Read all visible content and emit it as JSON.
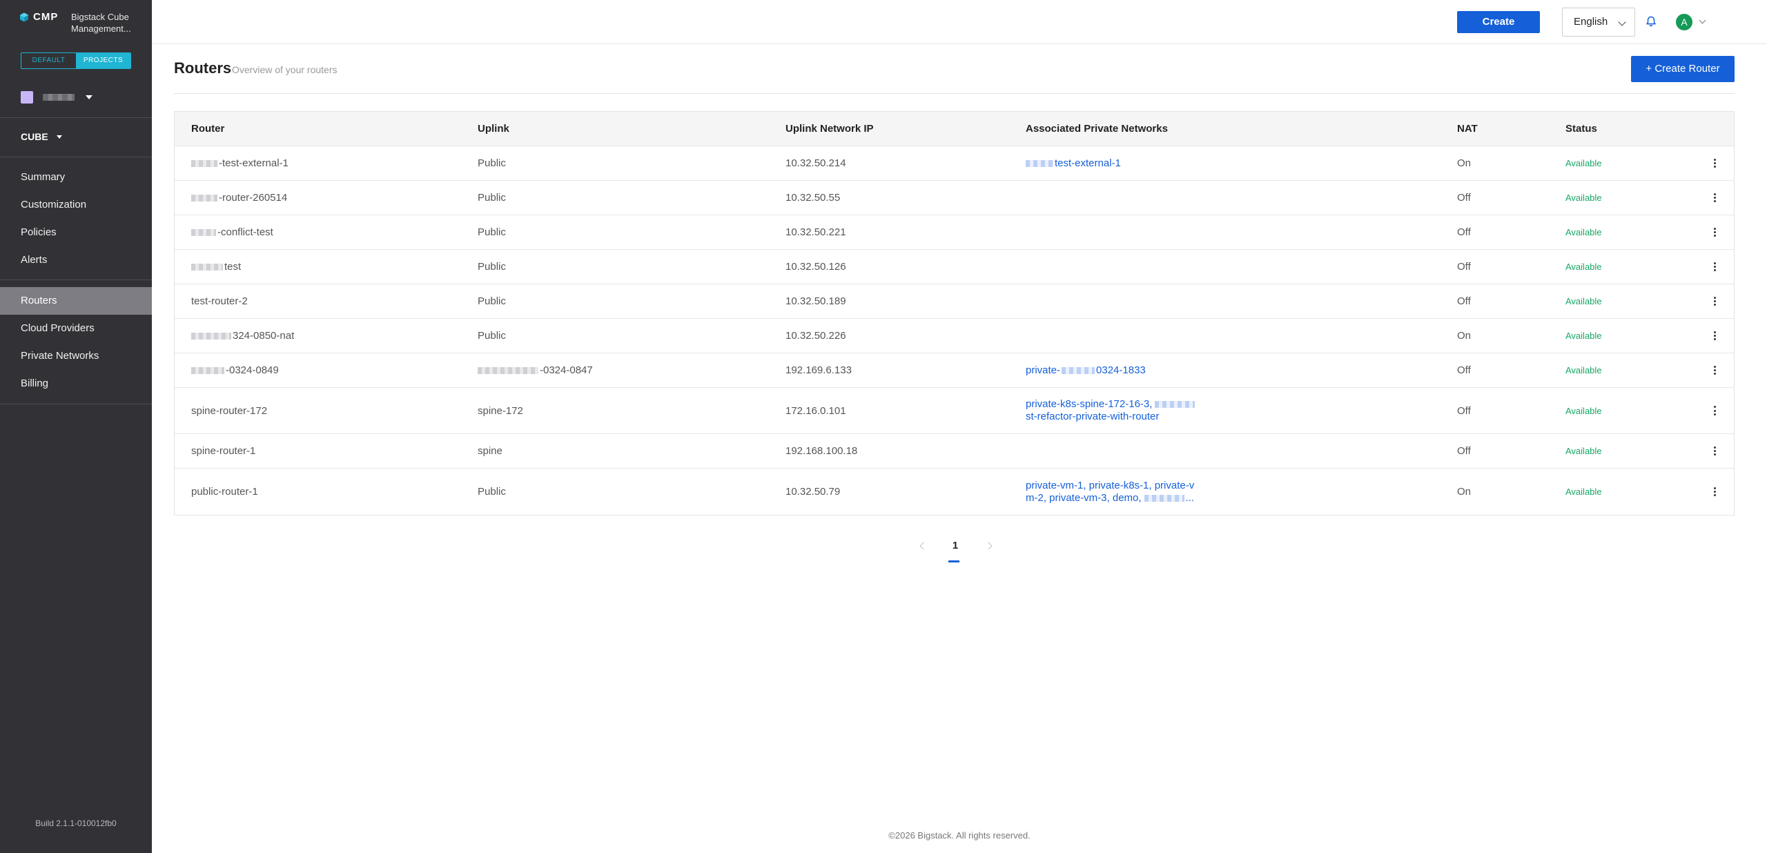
{
  "sidebar": {
    "brand": "CMP",
    "title": "Bigstack Cube Management...",
    "switch_default": "DEFAULT",
    "switch_projects": "PROJECTS",
    "region": "CUBE",
    "nav": [
      {
        "label": "Summary"
      },
      {
        "label": "Customization"
      },
      {
        "label": "Policies"
      },
      {
        "label": "Alerts"
      },
      {
        "label": "Routers"
      },
      {
        "label": "Cloud Providers"
      },
      {
        "label": "Private Networks"
      },
      {
        "label": "Billing"
      }
    ],
    "build": "Build 2.1.1-010012fb0"
  },
  "topbar": {
    "create_label": "Create",
    "language": "English",
    "avatar_initial": "A"
  },
  "header": {
    "title": "Routers",
    "subtitle": "Overview of your routers",
    "create_router_label": "+ Create Router"
  },
  "table": {
    "columns": [
      "Router",
      "Uplink",
      "Uplink Network IP",
      "Associated Private Networks",
      "NAT",
      "Status"
    ],
    "rows": [
      {
        "router": "-test-external-1",
        "uplink": "Public",
        "ip": "10.32.50.214",
        "networks": "test-external-1",
        "nat": "On",
        "status": "Available"
      },
      {
        "router": "-router-260514",
        "uplink": "Public",
        "ip": "10.32.50.55",
        "networks": "",
        "nat": "Off",
        "status": "Available"
      },
      {
        "router": "-conflict-test",
        "uplink": "Public",
        "ip": "10.32.50.221",
        "networks": "",
        "nat": "Off",
        "status": "Available"
      },
      {
        "router": "test",
        "uplink": "Public",
        "ip": "10.32.50.126",
        "networks": "",
        "nat": "Off",
        "status": "Available"
      },
      {
        "router": "test-router-2",
        "uplink": "Public",
        "ip": "10.32.50.189",
        "networks": "",
        "nat": "Off",
        "status": "Available"
      },
      {
        "router": "324-0850-nat",
        "uplink": "Public",
        "ip": "10.32.50.226",
        "networks": "",
        "nat": "On",
        "status": "Available"
      },
      {
        "router": "-0324-0849",
        "uplink": "-0324-0847",
        "ip": "192.169.6.133",
        "networks": "private-",
        "networks_tail": "0324-1833",
        "nat": "Off",
        "status": "Available"
      },
      {
        "router": "spine-router-172",
        "uplink": "spine-172",
        "ip": "172.16.0.101",
        "networks": "private-k8s-spine-172-16-3,",
        "networks_line2": "st-refactor-private-with-router",
        "nat": "Off",
        "status": "Available"
      },
      {
        "router": "spine-router-1",
        "uplink": "spine",
        "ip": "192.168.100.18",
        "networks": "",
        "nat": "Off",
        "status": "Available"
      },
      {
        "router": "public-router-1",
        "uplink": "Public",
        "ip": "10.32.50.79",
        "networks": "private-vm-1, private-k8s-1, private-v",
        "networks_line2": "m-2, private-vm-3, demo,",
        "networks_line2_tail": "...",
        "nat": "On",
        "status": "Available"
      }
    ]
  },
  "pagination": {
    "current": "1"
  },
  "footer": {
    "copyright": "©2026 Bigstack. All rights reserved."
  }
}
